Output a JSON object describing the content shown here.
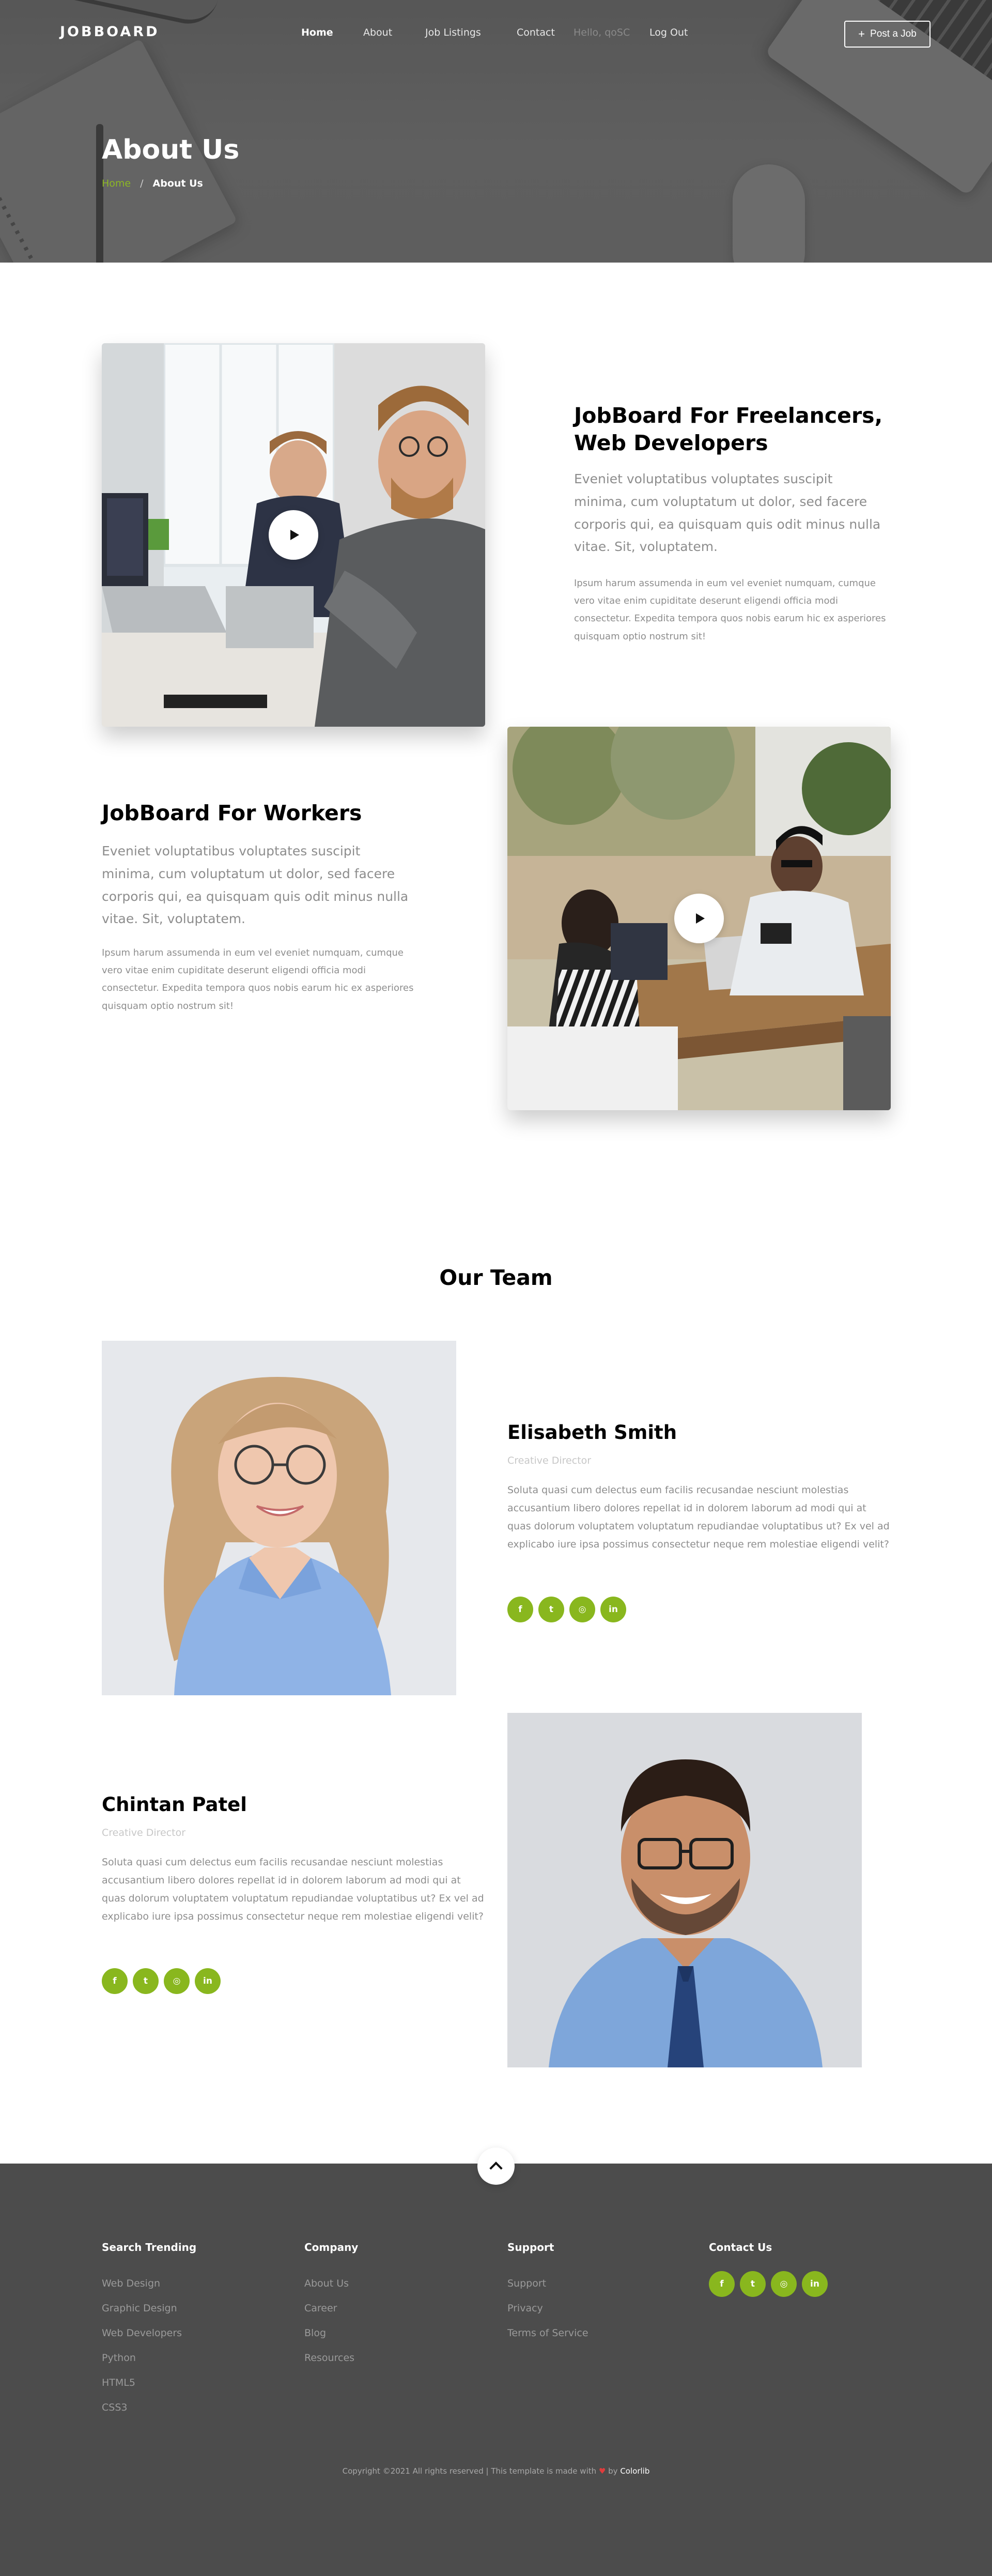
{
  "nav": {
    "brand": "JOBBOARD",
    "links": [
      "Home",
      "About",
      "Job Listings",
      "Contact"
    ],
    "muted": "Hello, qoSC",
    "logout": "Log Out",
    "post_job_plus": "+",
    "post_job": "Post a Job"
  },
  "hero": {
    "title": "About Us",
    "breadcrumb_home": "Home",
    "breadcrumb_sep": "/",
    "breadcrumb_current": "About Us"
  },
  "features": [
    {
      "title_line1": "JobBoard For Freelancers,",
      "title_line2": "Web Developers",
      "lead": "Eveniet voluptatibus voluptates suscipit minima, cum voluptatum ut dolor, sed facere corporis qui, ea quisquam quis odit minus nulla vitae. Sit, voluptatem.",
      "body": "Ipsum harum assumenda in eum vel eveniet numquam, cumque vero vitae enim cupiditate deserunt eligendi officia modi consectetur. Expedita tempora quos nobis earum hic ex asperiores quisquam optio nostrum sit!"
    },
    {
      "title_line1": "JobBoard For Workers",
      "lead": "Eveniet voluptatibus voluptates suscipit minima, cum voluptatum ut dolor, sed facere corporis qui, ea quisquam quis odit minus nulla vitae. Sit, voluptatem.",
      "body": "Ipsum harum assumenda in eum vel eveniet numquam, cumque vero vitae enim cupiditate deserunt eligendi officia modi consectetur. Expedita tempora quos nobis earum hic ex asperiores quisquam optio nostrum sit!"
    }
  ],
  "team": {
    "heading": "Our Team",
    "members": [
      {
        "name": "Elisabeth Smith",
        "role": "Creative Director",
        "bio": "Soluta quasi cum delectus eum facilis recusandae nesciunt molestias accusantium libero dolores repellat id in dolorem laborum ad modi qui at quas dolorum voluptatem voluptatum repudiandae voluptatibus ut? Ex vel ad explicabo iure ipsa possimus consectetur neque rem molestiae eligendi velit?"
      },
      {
        "name": "Chintan Patel",
        "role": "Creative Director",
        "bio": "Soluta quasi cum delectus eum facilis recusandae nesciunt molestias accusantium libero dolores repellat id in dolorem laborum ad modi qui at quas dolorum voluptatem voluptatum repudiandae voluptatibus ut? Ex vel ad explicabo iure ipsa possimus consectetur neque rem molestiae eligendi velit?"
      }
    ],
    "social_icons": [
      "facebook-icon",
      "twitter-icon",
      "instagram-icon",
      "linkedin-icon"
    ]
  },
  "footer": {
    "columns": [
      {
        "title": "Search Trending",
        "links": [
          "Web Design",
          "Graphic Design",
          "Web Developers",
          "Python",
          "HTML5",
          "CSS3"
        ]
      },
      {
        "title": "Company",
        "links": [
          "About Us",
          "Career",
          "Blog",
          "Resources"
        ]
      },
      {
        "title": "Support",
        "links": [
          "Support",
          "Privacy",
          "Terms of Service"
        ]
      },
      {
        "title": "Contact Us",
        "links": []
      }
    ],
    "copyright_pre": "Copyright ©2021 All rights reserved | This template is made with",
    "copyright_by": "by",
    "copyright_brand": "Colorlib"
  },
  "colors": {
    "accent": "#89b71e",
    "footer_bg": "#4c4c4c",
    "hero_bg": "#666666"
  }
}
